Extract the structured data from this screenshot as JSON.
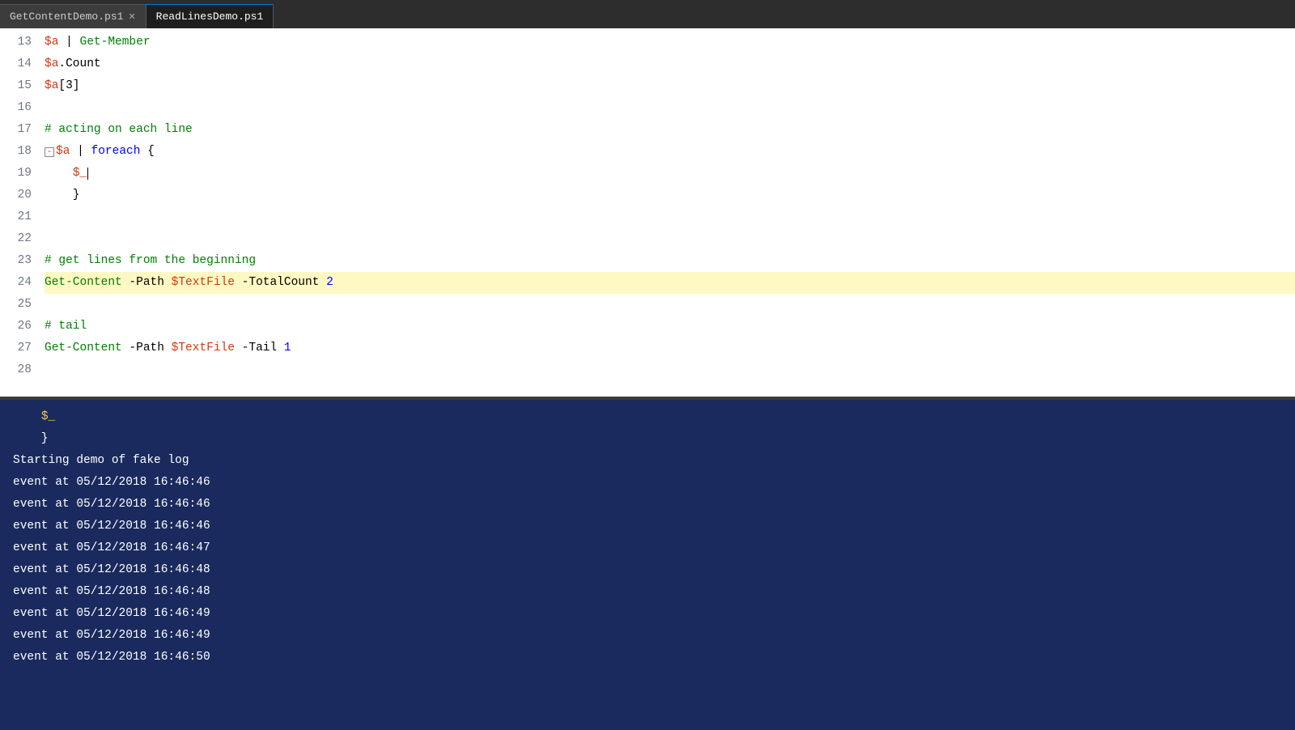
{
  "tabs": [
    {
      "id": "tab1",
      "label": "GetContentDemo.ps1",
      "active": false,
      "closable": true
    },
    {
      "id": "tab2",
      "label": "ReadLinesDemo.ps1",
      "active": true,
      "closable": false
    }
  ],
  "editor": {
    "lines": [
      {
        "num": 13,
        "tokens": [
          {
            "t": "$a",
            "c": "variable"
          },
          {
            "t": " | ",
            "c": "plain"
          },
          {
            "t": "Get-Member",
            "c": "cmdlet"
          }
        ]
      },
      {
        "num": 14,
        "tokens": [
          {
            "t": "$a",
            "c": "variable"
          },
          {
            "t": ".Count",
            "c": "plain"
          }
        ]
      },
      {
        "num": 15,
        "tokens": [
          {
            "t": "$a",
            "c": "variable"
          },
          {
            "t": "[3]",
            "c": "plain"
          }
        ]
      },
      {
        "num": 16,
        "tokens": []
      },
      {
        "num": 17,
        "tokens": [
          {
            "t": "# acting on each line",
            "c": "comment"
          }
        ]
      },
      {
        "num": 18,
        "tokens": [
          {
            "t": "$a",
            "c": "variable"
          },
          {
            "t": " | ",
            "c": "plain"
          },
          {
            "t": "foreach",
            "c": "keyword"
          },
          {
            "t": " {",
            "c": "plain"
          }
        ],
        "fold": true
      },
      {
        "num": 19,
        "tokens": [
          {
            "t": "    ",
            "c": "plain"
          },
          {
            "t": "$_",
            "c": "variable"
          },
          {
            "t": "  ",
            "c": "plain"
          },
          {
            "t": "cursor",
            "c": "cursor"
          }
        ]
      },
      {
        "num": 20,
        "tokens": [
          {
            "t": "    }",
            "c": "plain"
          }
        ]
      },
      {
        "num": 21,
        "tokens": []
      },
      {
        "num": 22,
        "tokens": []
      },
      {
        "num": 23,
        "tokens": [
          {
            "t": "# get lines from the beginning",
            "c": "comment"
          }
        ]
      },
      {
        "num": 24,
        "tokens": [
          {
            "t": "Get-Content",
            "c": "cmdlet"
          },
          {
            "t": " -Path ",
            "c": "plain"
          },
          {
            "t": "$TextFile",
            "c": "variable"
          },
          {
            "t": " -TotalCount ",
            "c": "plain"
          },
          {
            "t": "2",
            "c": "number"
          }
        ],
        "highlight": true
      },
      {
        "num": 25,
        "tokens": []
      },
      {
        "num": 26,
        "tokens": [
          {
            "t": "# tail",
            "c": "comment"
          }
        ]
      },
      {
        "num": 27,
        "tokens": [
          {
            "t": "Get-Content",
            "c": "cmdlet"
          },
          {
            "t": " -Path ",
            "c": "plain"
          },
          {
            "t": "$TextFile",
            "c": "variable"
          },
          {
            "t": " -Tail ",
            "c": "plain"
          },
          {
            "t": "1",
            "c": "number"
          }
        ]
      },
      {
        "num": 28,
        "tokens": []
      }
    ]
  },
  "terminal": {
    "lines": [
      "    $_",
      "    }",
      "Starting demo of fake log",
      "event at 05/12/2018 16:46:46",
      "event at 05/12/2018 16:46:46",
      "event at 05/12/2018 16:46:46",
      "event at 05/12/2018 16:46:47",
      "event at 05/12/2018 16:46:48",
      "event at 05/12/2018 16:46:48",
      "event at 05/12/2018 16:46:49",
      "event at 05/12/2018 16:46:49",
      "event at 05/12/2018 16:46:50"
    ]
  }
}
